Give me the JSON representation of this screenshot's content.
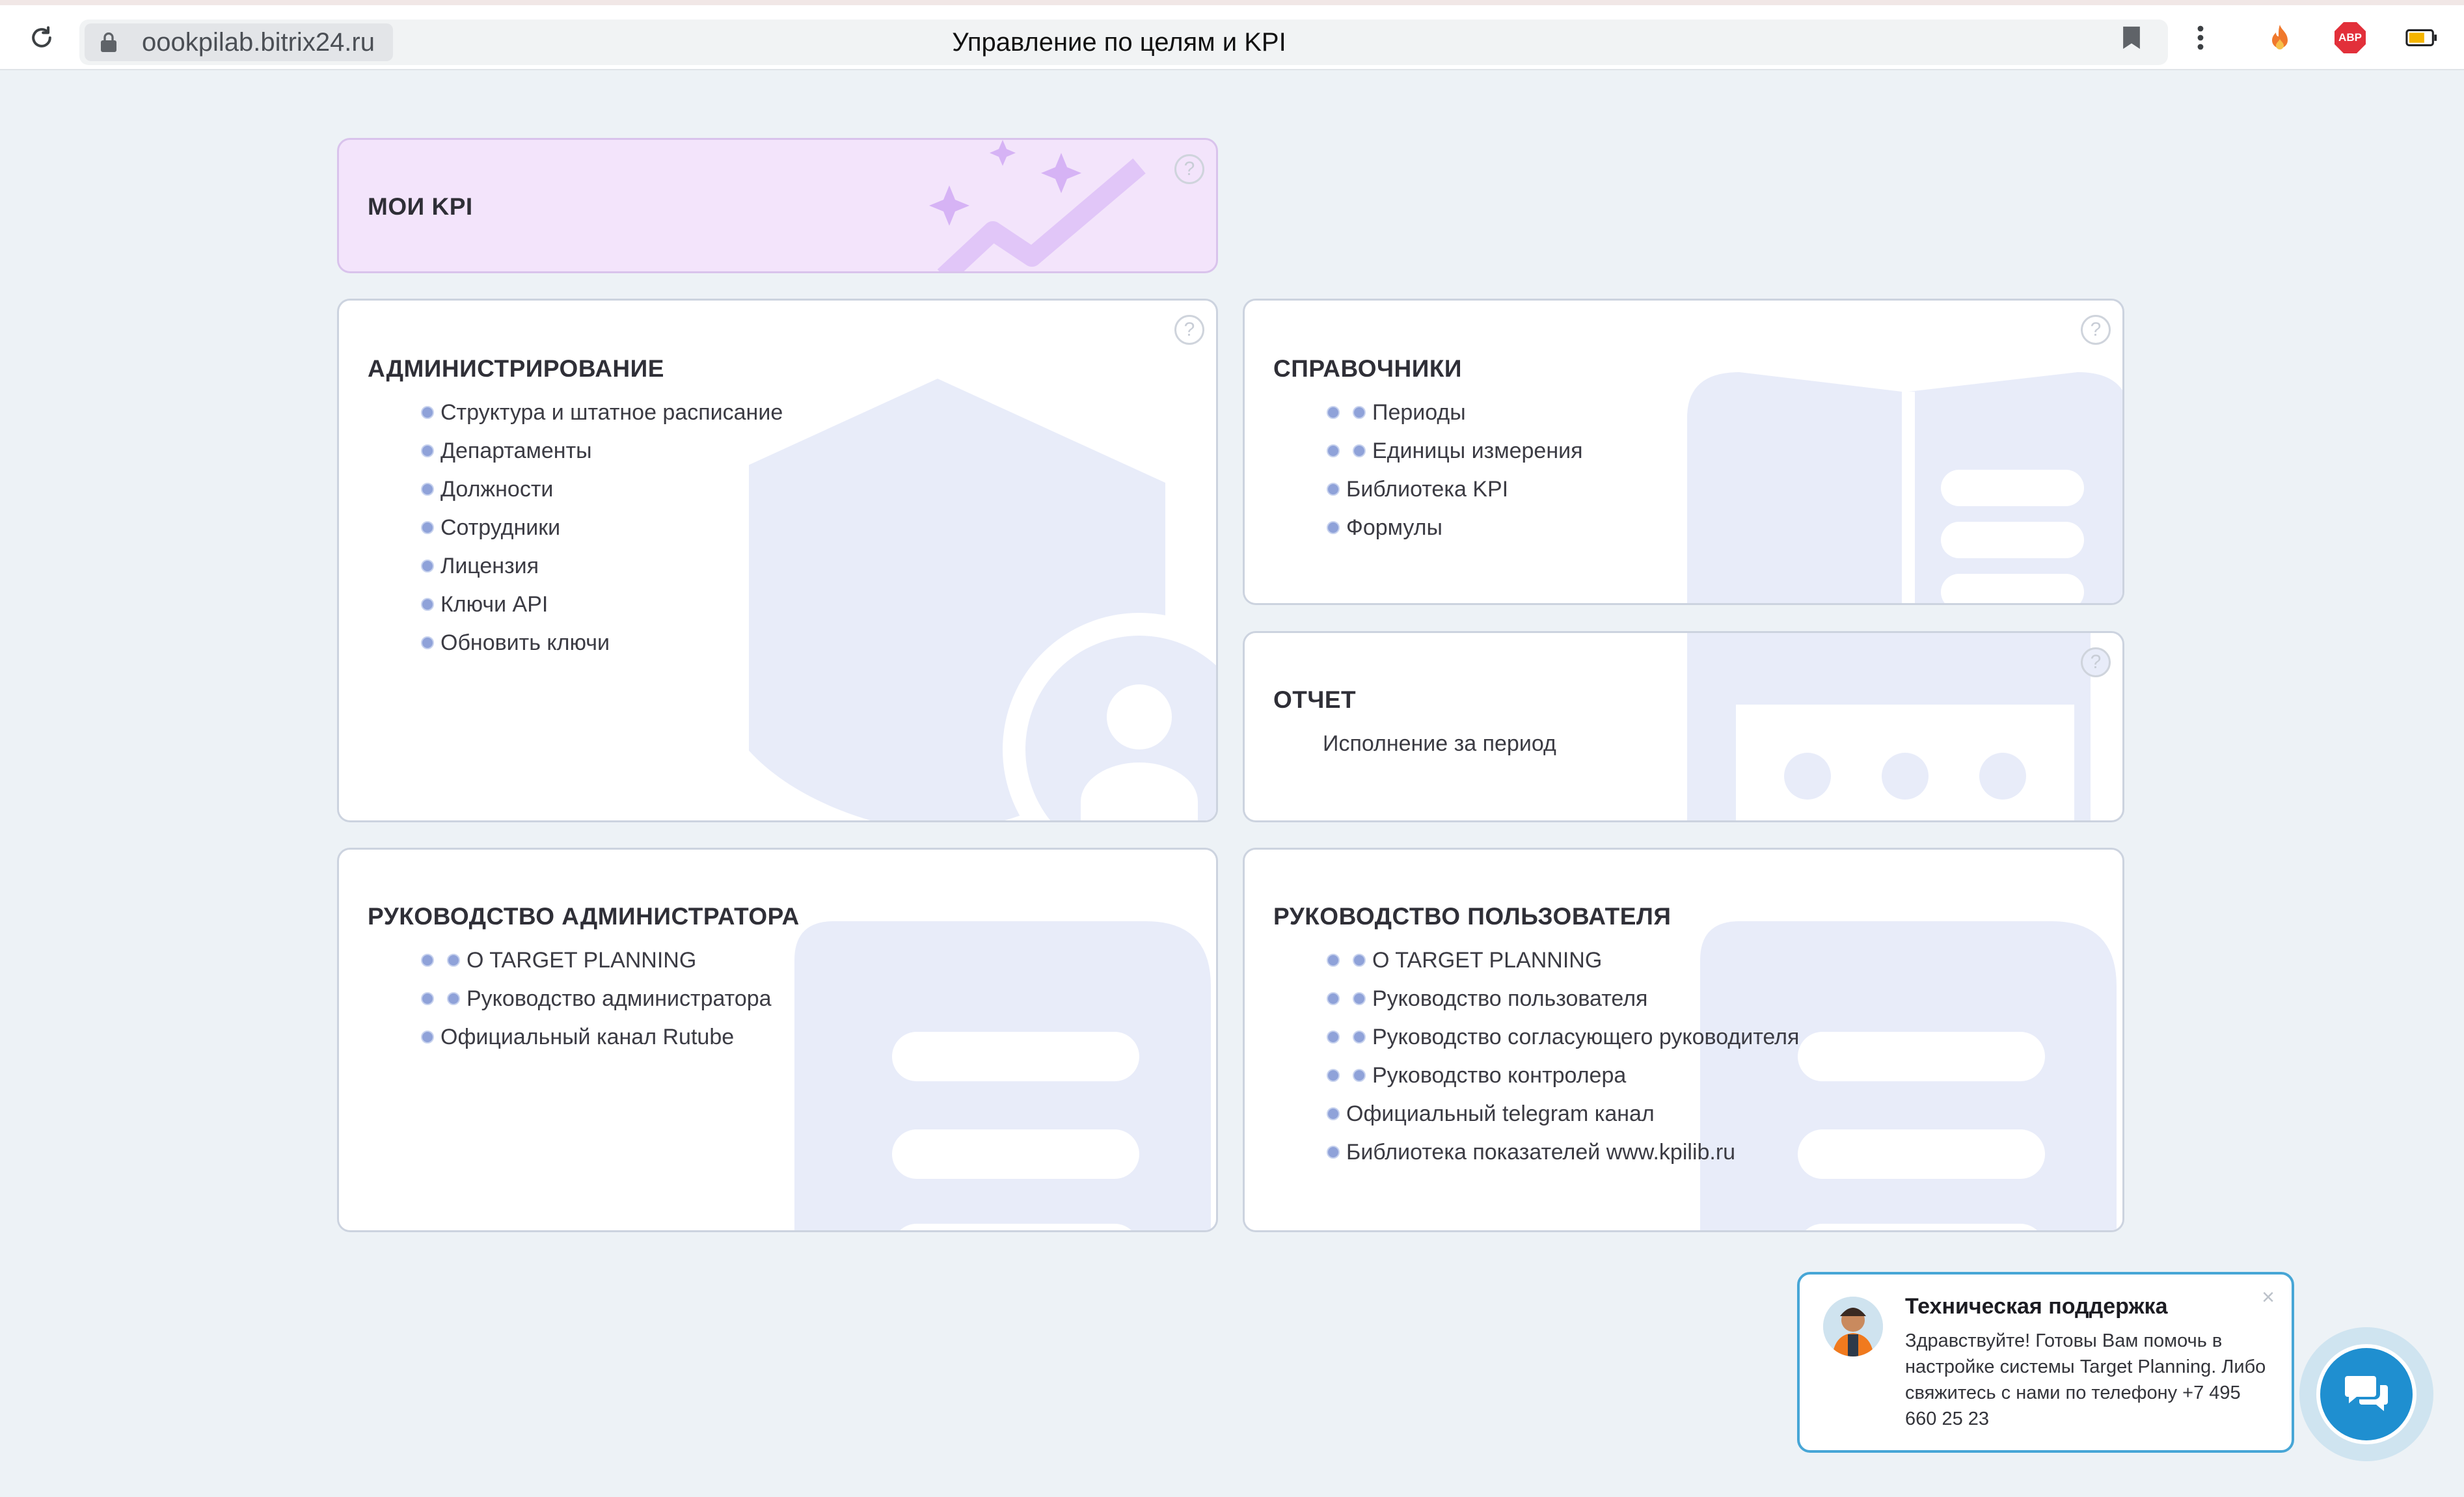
{
  "browser": {
    "url": "oookpilab.bitrix24.ru",
    "page_title": "Управление по целям и KPI",
    "extension_badge": "ABP"
  },
  "cards": {
    "my_kpi": {
      "title": "МОИ KPI"
    },
    "admin": {
      "title": "АДМИНИСТРИРОВАНИЕ",
      "items": [
        "Структура и штатное расписание",
        "Департаменты",
        "Должности",
        "Сотрудники",
        "Лицензия",
        "Ключи API",
        "Обновить ключи"
      ]
    },
    "reference": {
      "title": "СПРАВОЧНИКИ",
      "items": [
        "Периоды",
        "Единицы измерения",
        "Библиотека KPI",
        "Формулы"
      ]
    },
    "report": {
      "title": "ОТЧЕТ",
      "items": [
        "Исполнение за период"
      ]
    },
    "admin_guide": {
      "title": "РУКОВОДСТВО АДМИНИСТРАТОРА",
      "items": [
        "O TARGET PLANNING",
        "Руководство администратора",
        "Официальный канал Rutube"
      ]
    },
    "user_guide": {
      "title": "РУКОВОДСТВО ПОЛЬЗОВАТЕЛЯ",
      "items": [
        "O TARGET PLANNING",
        "Руководство пользователя",
        "Руководство согласующего руководителя",
        "Руководство контролера",
        "Официальный telegram канал",
        "Библиотека показателей www.kpilib.ru"
      ]
    }
  },
  "support": {
    "title": "Техническая поддержка",
    "message": "Здравствуйте! Готовы Вам помочь в настройке системы Target Planning. Либо свяжитесь с нами по телефону +7 495 660 25 23",
    "close_label": "×"
  },
  "help_label": "?",
  "colors": {
    "page_bg": "#edf2f6",
    "kpi_card_bg": "#f3e4fb",
    "accent_purple": "#c9a4f0",
    "decor_blue": "#e8ecf9",
    "bullet": "#8fa2d9",
    "support_border": "#47a6d6",
    "chat_button": "#1f8fd0"
  }
}
